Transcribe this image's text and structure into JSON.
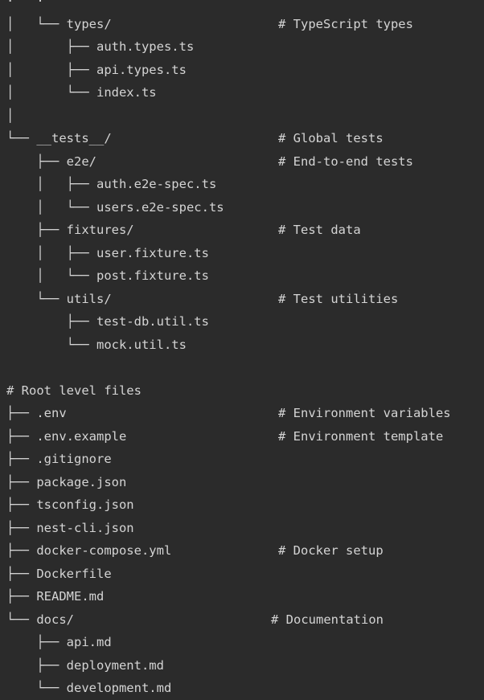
{
  "lines": [
    {
      "tree": "·   ·",
      "name": "",
      "comment": ""
    },
    {
      "tree": "│   └── ",
      "name": "types/",
      "comment": "# TypeScript types"
    },
    {
      "tree": "│       ├── ",
      "name": "auth.types.ts",
      "comment": ""
    },
    {
      "tree": "│       ├── ",
      "name": "api.types.ts",
      "comment": ""
    },
    {
      "tree": "│       └── ",
      "name": "index.ts",
      "comment": ""
    },
    {
      "tree": "│",
      "name": "",
      "comment": ""
    },
    {
      "tree": "└── ",
      "name": "__tests__/",
      "comment": "# Global tests"
    },
    {
      "tree": "    ├── ",
      "name": "e2e/",
      "comment": "# End-to-end tests"
    },
    {
      "tree": "    │   ├── ",
      "name": "auth.e2e-spec.ts",
      "comment": ""
    },
    {
      "tree": "    │   └── ",
      "name": "users.e2e-spec.ts",
      "comment": ""
    },
    {
      "tree": "    ├── ",
      "name": "fixtures/",
      "comment": "# Test data"
    },
    {
      "tree": "    │   ├── ",
      "name": "user.fixture.ts",
      "comment": ""
    },
    {
      "tree": "    │   └── ",
      "name": "post.fixture.ts",
      "comment": ""
    },
    {
      "tree": "    └── ",
      "name": "utils/",
      "comment": "# Test utilities"
    },
    {
      "tree": "        ├── ",
      "name": "test-db.util.ts",
      "comment": ""
    },
    {
      "tree": "        └── ",
      "name": "mock.util.ts",
      "comment": ""
    },
    {
      "tree": "",
      "name": "",
      "comment": ""
    },
    {
      "tree": "",
      "name": "# Root level files",
      "comment": ""
    },
    {
      "tree": "├── ",
      "name": ".env",
      "comment": "# Environment variables"
    },
    {
      "tree": "├── ",
      "name": ".env.example",
      "comment": "# Environment template"
    },
    {
      "tree": "├── ",
      "name": ".gitignore",
      "comment": ""
    },
    {
      "tree": "├── ",
      "name": "package.json",
      "comment": ""
    },
    {
      "tree": "├── ",
      "name": "tsconfig.json",
      "comment": ""
    },
    {
      "tree": "├── ",
      "name": "nest-cli.json",
      "comment": ""
    },
    {
      "tree": "├── ",
      "name": "docker-compose.yml",
      "comment": "# Docker setup"
    },
    {
      "tree": "├── ",
      "name": "Dockerfile",
      "comment": ""
    },
    {
      "tree": "├── ",
      "name": "README.md",
      "comment": ""
    },
    {
      "tree": "└── ",
      "name": "docs/",
      "comment": "# Documentation"
    },
    {
      "tree": "    ├── ",
      "name": "api.md",
      "comment": ""
    },
    {
      "tree": "    ├── ",
      "name": "deployment.md",
      "comment": ""
    },
    {
      "tree": "    └── ",
      "name": "development.md",
      "comment": ""
    }
  ]
}
